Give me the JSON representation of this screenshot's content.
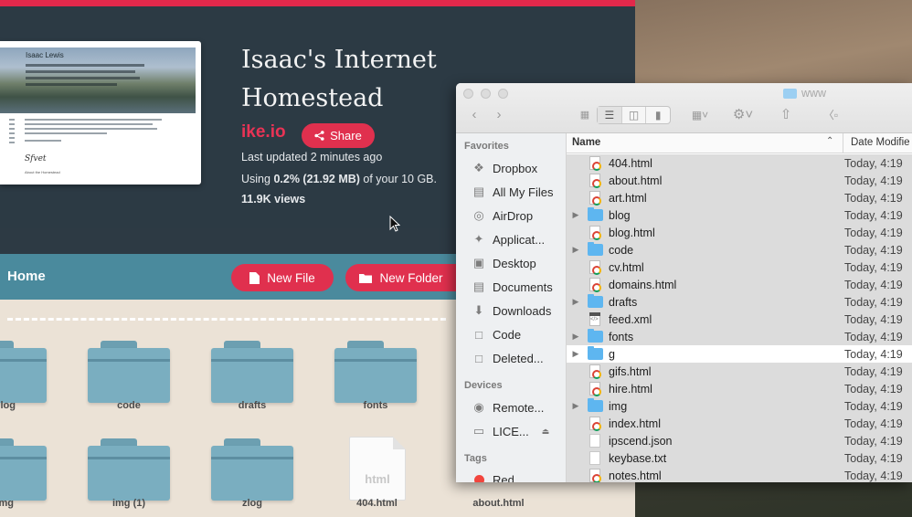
{
  "web": {
    "title": "Isaac's Internet Homestead",
    "domain": "ike.io",
    "share_label": "Share",
    "updated": "Last updated 2 minutes ago",
    "usage_prefix": "Using ",
    "usage_bold": "0.2% (21.92 MB)",
    "usage_suffix": " of your 10 GB.",
    "views": "11.9K views",
    "preview": {
      "name": "Isaac Lewis",
      "signature": "Sfvet",
      "footer": "About the Homestead"
    },
    "toolbar": {
      "home_label": "Home",
      "new_file_label": "New File",
      "new_folder_label": "New Folder"
    },
    "tiles": [
      {
        "label": "blog",
        "kind": "folder"
      },
      {
        "label": "code",
        "kind": "folder"
      },
      {
        "label": "drafts",
        "kind": "folder"
      },
      {
        "label": "fonts",
        "kind": "folder"
      },
      {
        "label": "img",
        "kind": "folder"
      },
      {
        "label": "img (1)",
        "kind": "folder"
      },
      {
        "label": "zlog",
        "kind": "folder"
      },
      {
        "label": "404.html",
        "kind": "file",
        "ext": "html"
      },
      {
        "label": "about.html",
        "kind": "file"
      }
    ]
  },
  "finder": {
    "window_title": "www",
    "sidebar": {
      "favorites_heading": "Favorites",
      "favorites": [
        {
          "label": "Dropbox",
          "icon": "dropbox-icon"
        },
        {
          "label": "All My Files",
          "icon": "all-files-icon"
        },
        {
          "label": "AirDrop",
          "icon": "airdrop-icon"
        },
        {
          "label": "Applicat...",
          "icon": "applications-icon"
        },
        {
          "label": "Desktop",
          "icon": "desktop-icon"
        },
        {
          "label": "Documents",
          "icon": "documents-icon"
        },
        {
          "label": "Downloads",
          "icon": "downloads-icon"
        },
        {
          "label": "Code",
          "icon": "folder-icon"
        },
        {
          "label": "Deleted...",
          "icon": "folder-icon"
        }
      ],
      "devices_heading": "Devices",
      "devices": [
        {
          "label": "Remote...",
          "icon": "remote-disc-icon"
        },
        {
          "label": "LICE...",
          "icon": "drive-icon"
        }
      ],
      "tags_heading": "Tags",
      "tags": [
        {
          "label": "Red",
          "color": "#f2453d"
        }
      ]
    },
    "columns": {
      "name": "Name",
      "date": "Date Modifie"
    },
    "rows": [
      {
        "name": "404.html",
        "type": "html",
        "date": "Today, 4:19",
        "folder": false
      },
      {
        "name": "about.html",
        "type": "html",
        "date": "Today, 4:19",
        "folder": false
      },
      {
        "name": "art.html",
        "type": "html",
        "date": "Today, 4:19",
        "folder": false
      },
      {
        "name": "blog",
        "type": "folder",
        "date": "Today, 4:19",
        "folder": true
      },
      {
        "name": "blog.html",
        "type": "html",
        "date": "Today, 4:19",
        "folder": false
      },
      {
        "name": "code",
        "type": "folder",
        "date": "Today, 4:19",
        "folder": true
      },
      {
        "name": "cv.html",
        "type": "html",
        "date": "Today, 4:19",
        "folder": false
      },
      {
        "name": "domains.html",
        "type": "html",
        "date": "Today, 4:19",
        "folder": false
      },
      {
        "name": "drafts",
        "type": "folder",
        "date": "Today, 4:19",
        "folder": true
      },
      {
        "name": "feed.xml",
        "type": "xml",
        "date": "Today, 4:19",
        "folder": false
      },
      {
        "name": "fonts",
        "type": "folder",
        "date": "Today, 4:19",
        "folder": true
      },
      {
        "name": "g",
        "type": "folder",
        "date": "Today, 4:19",
        "folder": true
      },
      {
        "name": "gifs.html",
        "type": "html",
        "date": "Today, 4:19",
        "folder": false
      },
      {
        "name": "hire.html",
        "type": "html",
        "date": "Today, 4:19",
        "folder": false
      },
      {
        "name": "img",
        "type": "folder",
        "date": "Today, 4:19",
        "folder": true
      },
      {
        "name": "index.html",
        "type": "html",
        "date": "Today, 4:19",
        "folder": false
      },
      {
        "name": "ipscend.json",
        "type": "doc",
        "date": "Today, 4:19",
        "folder": false
      },
      {
        "name": "keybase.txt",
        "type": "doc",
        "date": "Today, 4:19",
        "folder": false
      },
      {
        "name": "notes.html",
        "type": "html",
        "date": "Today, 4:19",
        "folder": false
      }
    ],
    "selected_rows": [
      0,
      1,
      2,
      3,
      4,
      5,
      6,
      7,
      8,
      9,
      10,
      12,
      13,
      14,
      15,
      16,
      17,
      18
    ]
  }
}
